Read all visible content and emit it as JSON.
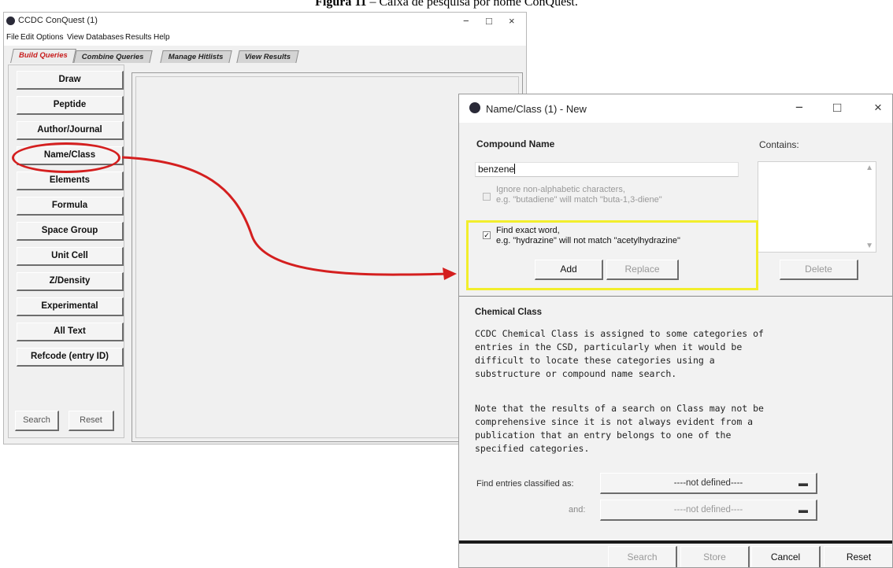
{
  "caption": {
    "figure": "Figura 11",
    "text": "– Caixa de pesquisa por nome ConQuest."
  },
  "main_window": {
    "title": "CCDC ConQuest (1)",
    "menu": [
      "File",
      "Edit",
      "Options",
      "View Databases",
      "Results",
      "Help"
    ],
    "tabs": [
      "Build Queries",
      "Combine Queries",
      "Manage Hitlists",
      "View Results"
    ],
    "query_buttons": [
      "Draw",
      "Peptide",
      "Author/Journal",
      "Name/Class",
      "Elements",
      "Formula",
      "Space Group",
      "Unit Cell",
      "Z/Density",
      "Experimental",
      "All Text",
      "Refcode (entry ID)"
    ],
    "search_label": "Search",
    "reset_label": "Reset",
    "window_controls": {
      "minimize": "−",
      "maximize": "□",
      "close": "×"
    }
  },
  "dialog": {
    "title": "Name/Class (1) - New",
    "window_controls": {
      "minimize": "−",
      "maximize": "□",
      "close": "×"
    },
    "compound_name_label": "Compound Name",
    "contains_label": "Contains:",
    "compound_value": "benzene",
    "ignore_option": {
      "checked": false,
      "line1": "Ignore non-alphabetic characters,",
      "line2": "e.g. \"butadiene\" will match \"buta-1,3-diene\""
    },
    "exact_option": {
      "checked": true,
      "check_mark": "✓",
      "line1": "Find exact word,",
      "line2": "e.g. \"hydrazine\" will not match \"acetylhydrazine\""
    },
    "add_label": "Add",
    "replace_label": "Replace",
    "delete_label": "Delete",
    "chemical_class_label": "Chemical Class",
    "class_text_1": "CCDC Chemical Class is assigned to some categories of\nentries in the CSD, particularly when it would be\ndifficult to locate these categories using a\nsubstructure or compound name search.",
    "class_text_2": "Note that the results of a search on Class may not be\ncomprehensive since it is not always evident from a\npublication that an entry belongs to one of the\nspecified categories.",
    "find_entries_label": "Find entries classified as:",
    "and_label": "and:",
    "select_1": "----not defined----",
    "select_2": "----not defined----",
    "footer_buttons": {
      "search": "Search",
      "store": "Store",
      "cancel": "Cancel",
      "reset": "Reset"
    }
  },
  "colors": {
    "annotation_red": "#d41f1f",
    "highlight_yellow": "#f2ee2c",
    "active_tab": "#c81e1e"
  }
}
